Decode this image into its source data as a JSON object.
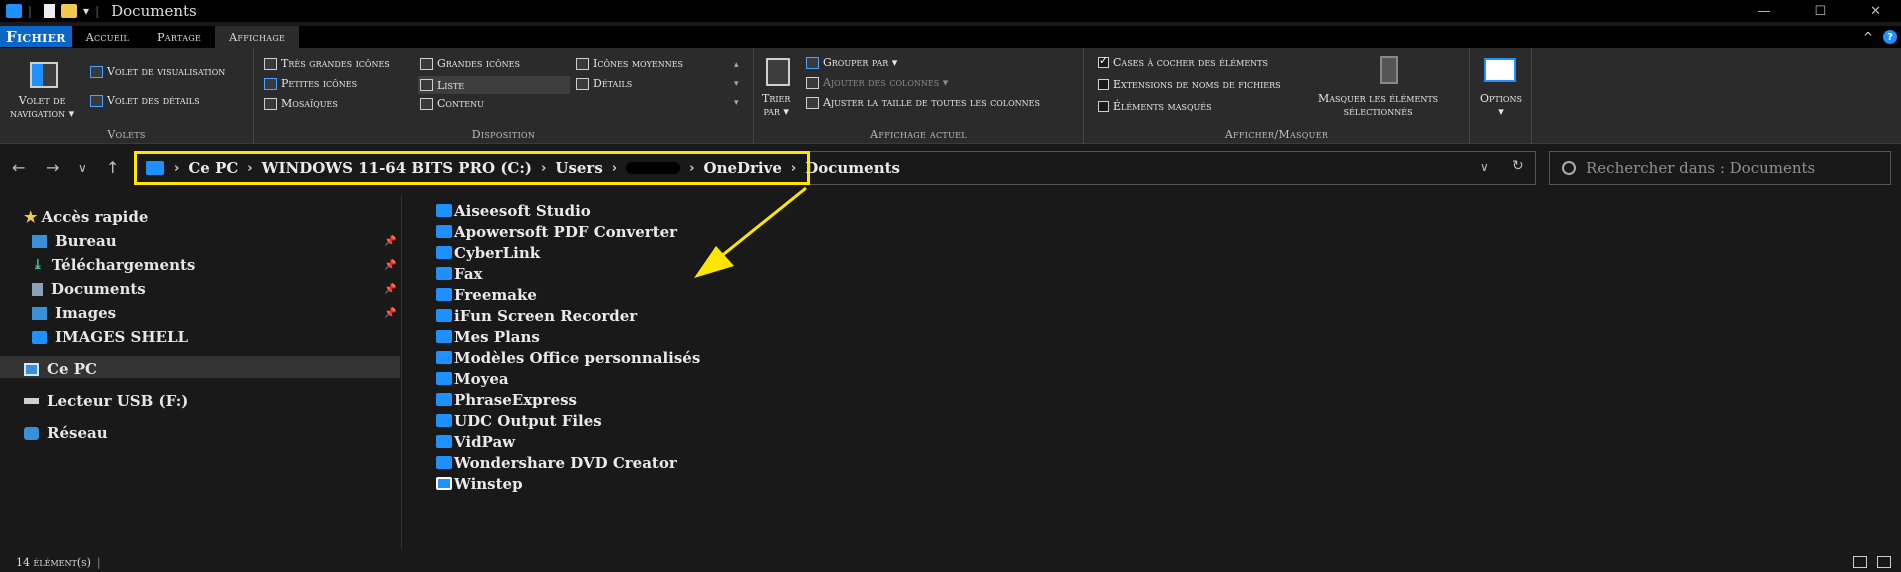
{
  "window": {
    "title": "Documents",
    "controls": {
      "minimize": "—",
      "maximize": "☐",
      "close": "✕"
    }
  },
  "ribbon_tabs": [
    "Fichier",
    "Accueil",
    "Partage",
    "Affichage"
  ],
  "ribbon": {
    "volets": {
      "label": "Volets",
      "nav_pane": [
        "Volet de",
        "navigation ▾"
      ],
      "preview": "Volet de visualisation",
      "details": "Volet des détails"
    },
    "disposition": {
      "label": "Disposition",
      "items": [
        "Très grandes icônes",
        "Grandes icônes",
        "Icônes moyennes",
        "Petites icônes",
        "Liste",
        "Détails",
        "Mosaïques",
        "Contenu"
      ],
      "selected": "Liste"
    },
    "affichage_actuel": {
      "label": "Affichage actuel",
      "sort": [
        "Trier",
        "par ▾"
      ],
      "group_by": "Grouper par ▾",
      "add_columns": "Ajouter des colonnes ▾",
      "fit_columns": "Ajuster la taille de toutes les colonnes"
    },
    "afficher_masquer": {
      "label": "Afficher/Masquer",
      "checkboxes": [
        {
          "label": "Cases à cocher des éléments",
          "checked": true
        },
        {
          "label": "Extensions de noms de fichiers",
          "checked": false
        },
        {
          "label": "Éléments masqués",
          "checked": false
        }
      ],
      "hide_selected": [
        "Masquer les éléments",
        "sélectionnés"
      ]
    },
    "options": {
      "label": "Options",
      "arrow": "▾"
    }
  },
  "address": {
    "crumbs": [
      "Ce PC",
      "WINDOWS 11-64 BITS PRO (C:)",
      "Users",
      "OneDrive",
      "Documents"
    ],
    "search_placeholder": "Rechercher dans : Documents"
  },
  "sidebar": {
    "quick_access": "Accès rapide",
    "pinned": [
      "Bureau",
      "Téléchargements",
      "Documents",
      "Images"
    ],
    "other": "IMAGES SHELL",
    "this_pc": "Ce PC",
    "usb": "Lecteur USB (F:)",
    "network": "Réseau"
  },
  "files": [
    "Aiseesoft Studio",
    "Apowersoft PDF Converter",
    "CyberLink",
    "Fax",
    "Freemake",
    "iFun Screen Recorder",
    "Mes Plans",
    "Modèles Office personnalisés",
    "Moyea",
    "PhraseExpress",
    "UDC Output Files",
    "VidPaw",
    "Wondershare DVD Creator",
    "Winstep"
  ],
  "status": {
    "count": "14 élément(s)",
    "sep": "|"
  },
  "colors": {
    "accent": "#0b67c5",
    "folder": "#1e90ff",
    "highlight": "#ffe600",
    "background": "#191919"
  }
}
